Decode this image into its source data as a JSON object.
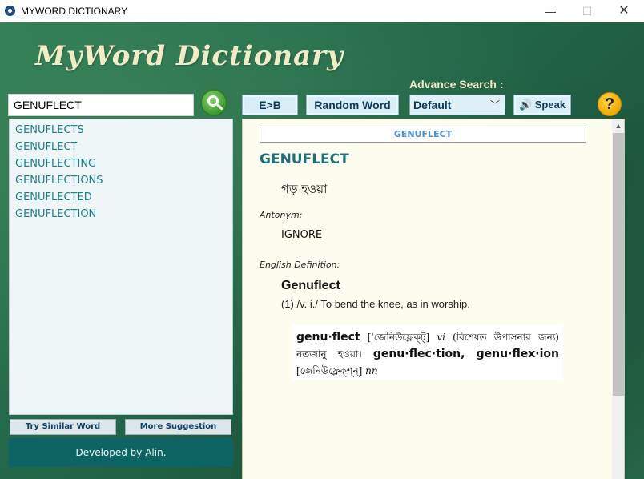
{
  "window": {
    "title": "MYWORD DICTIONARY",
    "minimize": "—",
    "maximize": "☐",
    "close": "✕"
  },
  "header": {
    "logo": "MyWord Dictionary"
  },
  "search": {
    "value": "GENUFLECT",
    "button_icon": "search-icon"
  },
  "toolbar": {
    "eb_label": "E>B",
    "random_label": "Random Word",
    "advance_search_label": "Advance Search :",
    "advance_search_value": "Default",
    "speak_label": "Speak",
    "help_label": "?"
  },
  "suggestions": [
    "GENUFLECTS",
    "GENUFLECT",
    "GENUFLECTING",
    "GENUFLECTIONS",
    "GENUFLECTED",
    "GENUFLECTION"
  ],
  "bottom_buttons": {
    "similar": "Try Similar Word",
    "more": "More Suggestion"
  },
  "footer": {
    "developer": "Developed by Alin."
  },
  "definition": {
    "header": "GENUFLECT",
    "word": "GENUFLECT",
    "bangla_meaning": "গড় হওয়া",
    "antonym_label": "Antonym:",
    "antonym": "IGNORE",
    "english_definition_label": "English Definition:",
    "definition_word": "Genuflect",
    "definition_text": "(1) /v. i./ To bend the knee, as in worship.",
    "dictionary_scan": {
      "headword": "genu·flect",
      "pronunciation": "[ˈজেনিউফ্লেক্ট্]",
      "pos1": "vi",
      "meaning": "(বিশেষত উপাসনার জন্য) নতজানু হওয়া।",
      "derived1": "genu·flec·tion,",
      "derived2": "genu·flex·ion",
      "pronunciation2": "[জেনিউফ্লেক্শ্ন্]",
      "pos2": "nn"
    }
  },
  "colors": {
    "accent_teal": "#1d6e7a",
    "list_text": "#1d7d8c",
    "dev_bar": "#0e6363",
    "background_green": "#23684a"
  }
}
